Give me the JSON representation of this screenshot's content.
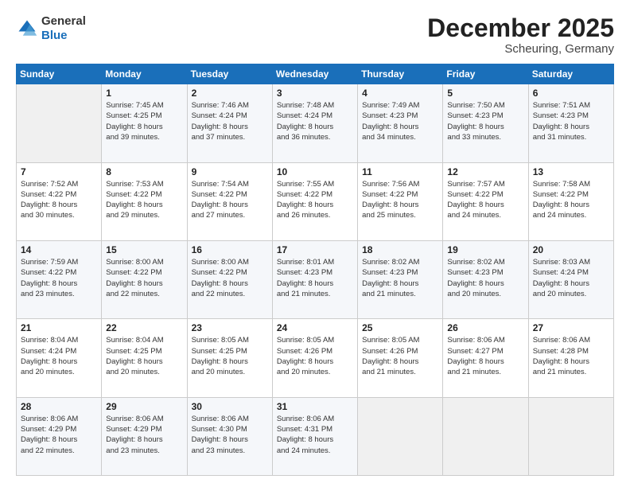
{
  "header": {
    "logo_line1": "General",
    "logo_line2": "Blue",
    "month": "December 2025",
    "location": "Scheuring, Germany"
  },
  "weekdays": [
    "Sunday",
    "Monday",
    "Tuesday",
    "Wednesday",
    "Thursday",
    "Friday",
    "Saturday"
  ],
  "weeks": [
    [
      {
        "day": "",
        "text": ""
      },
      {
        "day": "1",
        "text": "Sunrise: 7:45 AM\nSunset: 4:25 PM\nDaylight: 8 hours\nand 39 minutes."
      },
      {
        "day": "2",
        "text": "Sunrise: 7:46 AM\nSunset: 4:24 PM\nDaylight: 8 hours\nand 37 minutes."
      },
      {
        "day": "3",
        "text": "Sunrise: 7:48 AM\nSunset: 4:24 PM\nDaylight: 8 hours\nand 36 minutes."
      },
      {
        "day": "4",
        "text": "Sunrise: 7:49 AM\nSunset: 4:23 PM\nDaylight: 8 hours\nand 34 minutes."
      },
      {
        "day": "5",
        "text": "Sunrise: 7:50 AM\nSunset: 4:23 PM\nDaylight: 8 hours\nand 33 minutes."
      },
      {
        "day": "6",
        "text": "Sunrise: 7:51 AM\nSunset: 4:23 PM\nDaylight: 8 hours\nand 31 minutes."
      }
    ],
    [
      {
        "day": "7",
        "text": "Sunrise: 7:52 AM\nSunset: 4:22 PM\nDaylight: 8 hours\nand 30 minutes."
      },
      {
        "day": "8",
        "text": "Sunrise: 7:53 AM\nSunset: 4:22 PM\nDaylight: 8 hours\nand 29 minutes."
      },
      {
        "day": "9",
        "text": "Sunrise: 7:54 AM\nSunset: 4:22 PM\nDaylight: 8 hours\nand 27 minutes."
      },
      {
        "day": "10",
        "text": "Sunrise: 7:55 AM\nSunset: 4:22 PM\nDaylight: 8 hours\nand 26 minutes."
      },
      {
        "day": "11",
        "text": "Sunrise: 7:56 AM\nSunset: 4:22 PM\nDaylight: 8 hours\nand 25 minutes."
      },
      {
        "day": "12",
        "text": "Sunrise: 7:57 AM\nSunset: 4:22 PM\nDaylight: 8 hours\nand 24 minutes."
      },
      {
        "day": "13",
        "text": "Sunrise: 7:58 AM\nSunset: 4:22 PM\nDaylight: 8 hours\nand 24 minutes."
      }
    ],
    [
      {
        "day": "14",
        "text": "Sunrise: 7:59 AM\nSunset: 4:22 PM\nDaylight: 8 hours\nand 23 minutes."
      },
      {
        "day": "15",
        "text": "Sunrise: 8:00 AM\nSunset: 4:22 PM\nDaylight: 8 hours\nand 22 minutes."
      },
      {
        "day": "16",
        "text": "Sunrise: 8:00 AM\nSunset: 4:22 PM\nDaylight: 8 hours\nand 22 minutes."
      },
      {
        "day": "17",
        "text": "Sunrise: 8:01 AM\nSunset: 4:23 PM\nDaylight: 8 hours\nand 21 minutes."
      },
      {
        "day": "18",
        "text": "Sunrise: 8:02 AM\nSunset: 4:23 PM\nDaylight: 8 hours\nand 21 minutes."
      },
      {
        "day": "19",
        "text": "Sunrise: 8:02 AM\nSunset: 4:23 PM\nDaylight: 8 hours\nand 20 minutes."
      },
      {
        "day": "20",
        "text": "Sunrise: 8:03 AM\nSunset: 4:24 PM\nDaylight: 8 hours\nand 20 minutes."
      }
    ],
    [
      {
        "day": "21",
        "text": "Sunrise: 8:04 AM\nSunset: 4:24 PM\nDaylight: 8 hours\nand 20 minutes."
      },
      {
        "day": "22",
        "text": "Sunrise: 8:04 AM\nSunset: 4:25 PM\nDaylight: 8 hours\nand 20 minutes."
      },
      {
        "day": "23",
        "text": "Sunrise: 8:05 AM\nSunset: 4:25 PM\nDaylight: 8 hours\nand 20 minutes."
      },
      {
        "day": "24",
        "text": "Sunrise: 8:05 AM\nSunset: 4:26 PM\nDaylight: 8 hours\nand 20 minutes."
      },
      {
        "day": "25",
        "text": "Sunrise: 8:05 AM\nSunset: 4:26 PM\nDaylight: 8 hours\nand 21 minutes."
      },
      {
        "day": "26",
        "text": "Sunrise: 8:06 AM\nSunset: 4:27 PM\nDaylight: 8 hours\nand 21 minutes."
      },
      {
        "day": "27",
        "text": "Sunrise: 8:06 AM\nSunset: 4:28 PM\nDaylight: 8 hours\nand 21 minutes."
      }
    ],
    [
      {
        "day": "28",
        "text": "Sunrise: 8:06 AM\nSunset: 4:29 PM\nDaylight: 8 hours\nand 22 minutes."
      },
      {
        "day": "29",
        "text": "Sunrise: 8:06 AM\nSunset: 4:29 PM\nDaylight: 8 hours\nand 23 minutes."
      },
      {
        "day": "30",
        "text": "Sunrise: 8:06 AM\nSunset: 4:30 PM\nDaylight: 8 hours\nand 23 minutes."
      },
      {
        "day": "31",
        "text": "Sunrise: 8:06 AM\nSunset: 4:31 PM\nDaylight: 8 hours\nand 24 minutes."
      },
      {
        "day": "",
        "text": ""
      },
      {
        "day": "",
        "text": ""
      },
      {
        "day": "",
        "text": ""
      }
    ]
  ]
}
